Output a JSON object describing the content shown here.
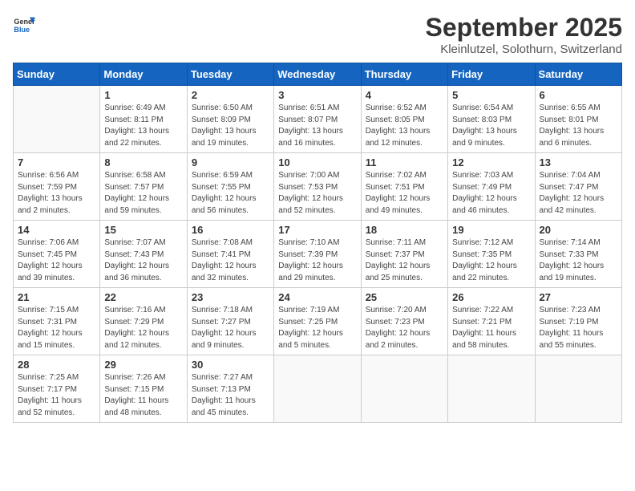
{
  "header": {
    "logo_line1": "General",
    "logo_line2": "Blue",
    "month_title": "September 2025",
    "location": "Kleinlutzel, Solothurn, Switzerland"
  },
  "weekdays": [
    "Sunday",
    "Monday",
    "Tuesday",
    "Wednesday",
    "Thursday",
    "Friday",
    "Saturday"
  ],
  "weeks": [
    [
      {
        "day": null
      },
      {
        "day": 1,
        "sunrise": "6:49 AM",
        "sunset": "8:11 PM",
        "daylight": "13 hours and 22 minutes."
      },
      {
        "day": 2,
        "sunrise": "6:50 AM",
        "sunset": "8:09 PM",
        "daylight": "13 hours and 19 minutes."
      },
      {
        "day": 3,
        "sunrise": "6:51 AM",
        "sunset": "8:07 PM",
        "daylight": "13 hours and 16 minutes."
      },
      {
        "day": 4,
        "sunrise": "6:52 AM",
        "sunset": "8:05 PM",
        "daylight": "13 hours and 12 minutes."
      },
      {
        "day": 5,
        "sunrise": "6:54 AM",
        "sunset": "8:03 PM",
        "daylight": "13 hours and 9 minutes."
      },
      {
        "day": 6,
        "sunrise": "6:55 AM",
        "sunset": "8:01 PM",
        "daylight": "13 hours and 6 minutes."
      }
    ],
    [
      {
        "day": 7,
        "sunrise": "6:56 AM",
        "sunset": "7:59 PM",
        "daylight": "13 hours and 2 minutes."
      },
      {
        "day": 8,
        "sunrise": "6:58 AM",
        "sunset": "7:57 PM",
        "daylight": "12 hours and 59 minutes."
      },
      {
        "day": 9,
        "sunrise": "6:59 AM",
        "sunset": "7:55 PM",
        "daylight": "12 hours and 56 minutes."
      },
      {
        "day": 10,
        "sunrise": "7:00 AM",
        "sunset": "7:53 PM",
        "daylight": "12 hours and 52 minutes."
      },
      {
        "day": 11,
        "sunrise": "7:02 AM",
        "sunset": "7:51 PM",
        "daylight": "12 hours and 49 minutes."
      },
      {
        "day": 12,
        "sunrise": "7:03 AM",
        "sunset": "7:49 PM",
        "daylight": "12 hours and 46 minutes."
      },
      {
        "day": 13,
        "sunrise": "7:04 AM",
        "sunset": "7:47 PM",
        "daylight": "12 hours and 42 minutes."
      }
    ],
    [
      {
        "day": 14,
        "sunrise": "7:06 AM",
        "sunset": "7:45 PM",
        "daylight": "12 hours and 39 minutes."
      },
      {
        "day": 15,
        "sunrise": "7:07 AM",
        "sunset": "7:43 PM",
        "daylight": "12 hours and 36 minutes."
      },
      {
        "day": 16,
        "sunrise": "7:08 AM",
        "sunset": "7:41 PM",
        "daylight": "12 hours and 32 minutes."
      },
      {
        "day": 17,
        "sunrise": "7:10 AM",
        "sunset": "7:39 PM",
        "daylight": "12 hours and 29 minutes."
      },
      {
        "day": 18,
        "sunrise": "7:11 AM",
        "sunset": "7:37 PM",
        "daylight": "12 hours and 25 minutes."
      },
      {
        "day": 19,
        "sunrise": "7:12 AM",
        "sunset": "7:35 PM",
        "daylight": "12 hours and 22 minutes."
      },
      {
        "day": 20,
        "sunrise": "7:14 AM",
        "sunset": "7:33 PM",
        "daylight": "12 hours and 19 minutes."
      }
    ],
    [
      {
        "day": 21,
        "sunrise": "7:15 AM",
        "sunset": "7:31 PM",
        "daylight": "12 hours and 15 minutes."
      },
      {
        "day": 22,
        "sunrise": "7:16 AM",
        "sunset": "7:29 PM",
        "daylight": "12 hours and 12 minutes."
      },
      {
        "day": 23,
        "sunrise": "7:18 AM",
        "sunset": "7:27 PM",
        "daylight": "12 hours and 9 minutes."
      },
      {
        "day": 24,
        "sunrise": "7:19 AM",
        "sunset": "7:25 PM",
        "daylight": "12 hours and 5 minutes."
      },
      {
        "day": 25,
        "sunrise": "7:20 AM",
        "sunset": "7:23 PM",
        "daylight": "12 hours and 2 minutes."
      },
      {
        "day": 26,
        "sunrise": "7:22 AM",
        "sunset": "7:21 PM",
        "daylight": "11 hours and 58 minutes."
      },
      {
        "day": 27,
        "sunrise": "7:23 AM",
        "sunset": "7:19 PM",
        "daylight": "11 hours and 55 minutes."
      }
    ],
    [
      {
        "day": 28,
        "sunrise": "7:25 AM",
        "sunset": "7:17 PM",
        "daylight": "11 hours and 52 minutes."
      },
      {
        "day": 29,
        "sunrise": "7:26 AM",
        "sunset": "7:15 PM",
        "daylight": "11 hours and 48 minutes."
      },
      {
        "day": 30,
        "sunrise": "7:27 AM",
        "sunset": "7:13 PM",
        "daylight": "11 hours and 45 minutes."
      },
      {
        "day": null
      },
      {
        "day": null
      },
      {
        "day": null
      },
      {
        "day": null
      }
    ]
  ]
}
